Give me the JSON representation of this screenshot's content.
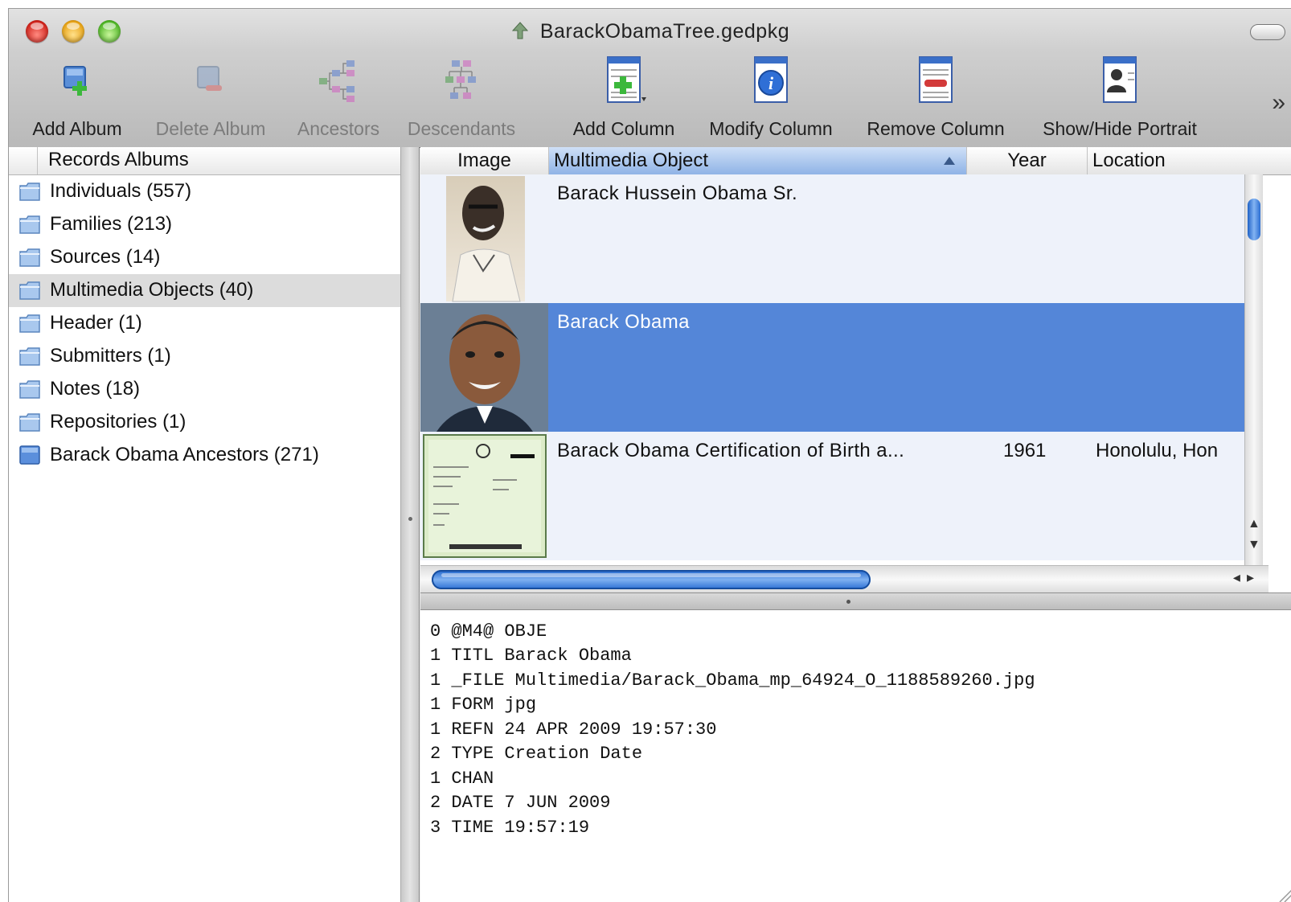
{
  "window": {
    "title": "BarackObamaTree.gedpkg"
  },
  "toolbar": {
    "items": [
      {
        "label": "Add Album",
        "icon": "add-album-icon",
        "enabled": true
      },
      {
        "label": "Delete Album",
        "icon": "delete-album-icon",
        "enabled": false
      },
      {
        "label": "Ancestors",
        "icon": "ancestors-tree-icon",
        "enabled": false
      },
      {
        "label": "Descendants",
        "icon": "descendants-tree-icon",
        "enabled": false
      },
      {
        "label": "Add Column",
        "icon": "add-column-icon",
        "enabled": true
      },
      {
        "label": "Modify Column",
        "icon": "modify-column-icon",
        "enabled": true
      },
      {
        "label": "Remove Column",
        "icon": "remove-column-icon",
        "enabled": true
      },
      {
        "label": "Show/Hide Portrait",
        "icon": "portrait-icon",
        "enabled": true
      }
    ],
    "overflow": "»"
  },
  "sidebar": {
    "header": "Records Albums",
    "items": [
      {
        "label": "Individuals (557)"
      },
      {
        "label": "Families (213)"
      },
      {
        "label": "Sources (14)"
      },
      {
        "label": "Multimedia Objects (40)",
        "selected": true
      },
      {
        "label": "Header (1)"
      },
      {
        "label": "Submitters (1)"
      },
      {
        "label": "Notes (18)"
      },
      {
        "label": "Repositories (1)"
      },
      {
        "label": "Barack Obama Ancestors (271)",
        "custom": true
      }
    ]
  },
  "table": {
    "columns": [
      "Image",
      "Multimedia Object",
      "Year",
      "Location"
    ],
    "sorted_column": "Multimedia Object",
    "rows": [
      {
        "object": "Barack Hussein Obama Sr.",
        "year": "",
        "location": ""
      },
      {
        "object": "Barack Obama",
        "year": "",
        "location": "",
        "selected": true
      },
      {
        "object": "Barack Obama Certification of Birth a...",
        "year": "1961",
        "location": "Honolulu, Hon"
      }
    ]
  },
  "gedcom": {
    "lines": [
      "0 @M4@ OBJE",
      "1 TITL Barack Obama",
      "1 _FILE Multimedia/Barack_Obama_mp_64924_O_1188589260.jpg",
      "1 FORM jpg",
      "1 REFN 24 APR 2009 19:57:30",
      "2 TYPE Creation Date",
      "1 CHAN",
      "2 DATE 7 JUN 2009",
      "3 TIME 19:57:19"
    ]
  },
  "colors": {
    "selection": "#5486d8",
    "row_background": "#eef2fa",
    "scroll_thumb": "#2a6ed3"
  }
}
